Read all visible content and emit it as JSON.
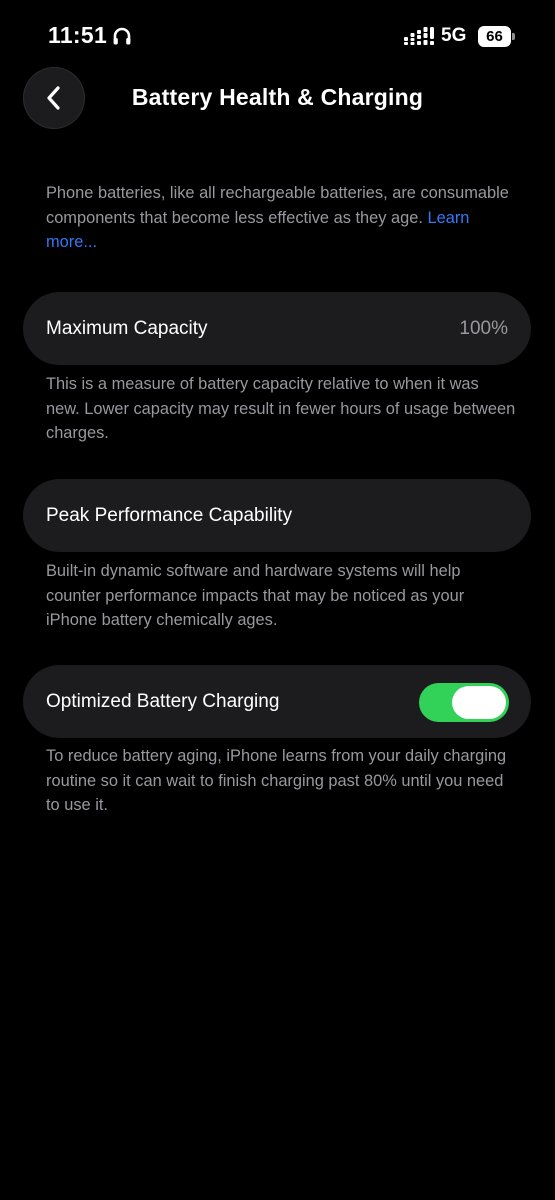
{
  "status_bar": {
    "time": "11:51",
    "network": "5G",
    "battery_level": "66",
    "icons": [
      "headphones-icon",
      "signal-icon",
      "battery-icon"
    ]
  },
  "header": {
    "title": "Battery Health & Charging",
    "back_icon": "chevron-left-icon"
  },
  "intro": {
    "text": "Phone batteries, like all rechargeable batteries, are consumable components that become less effective as they age.",
    "link": "Learn more..."
  },
  "max_capacity": {
    "label": "Maximum Capacity",
    "value": "100%",
    "description": "This is a measure of battery capacity relative to when it was new. Lower capacity may result in fewer hours of usage between charges."
  },
  "peak_performance": {
    "label": "Peak Performance Capability",
    "description": "Built-in dynamic software and hardware systems will help counter performance impacts that may be noticed as your iPhone battery chemically ages."
  },
  "optimized_charging": {
    "label": "Optimized Battery Charging",
    "enabled": true,
    "description": "To reduce battery aging, iPhone learns from your daily charging routine so it can wait to finish charging past 80% until you need to use it."
  },
  "colors": {
    "background": "#000000",
    "card": "#1c1c1e",
    "secondary_text": "#98989f",
    "link": "#3478f6",
    "toggle_on": "#32d158"
  }
}
